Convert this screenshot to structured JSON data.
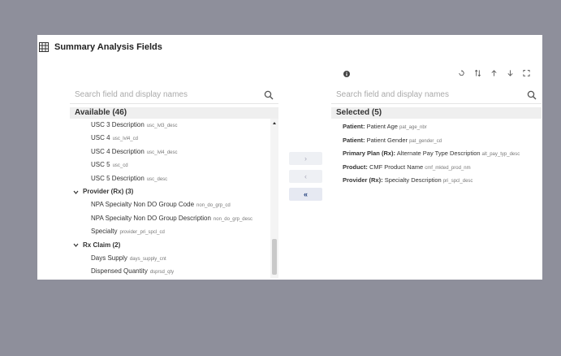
{
  "header": {
    "title": "Summary Analysis Fields",
    "icon": "table-grid-icon"
  },
  "available": {
    "search_placeholder": "Search field and display names",
    "title": "Available (46)",
    "rows": [
      {
        "type": "item",
        "label": "USC 3 Description",
        "code": "usc_lvl3_desc"
      },
      {
        "type": "item",
        "label": "USC 4",
        "code": "usc_lvl4_cd"
      },
      {
        "type": "item",
        "label": "USC 4 Description",
        "code": "usc_lvl4_desc"
      },
      {
        "type": "item",
        "label": "USC 5",
        "code": "usc_cd"
      },
      {
        "type": "item",
        "label": "USC 5 Description",
        "code": "usc_desc"
      },
      {
        "type": "group",
        "label": "Provider (Rx) (3)"
      },
      {
        "type": "item",
        "label": "NPA Specialty Non DO Group Code",
        "code": "non_do_grp_cd"
      },
      {
        "type": "item",
        "label": "NPA Specialty Non DO Group Description",
        "code": "non_do_grp_desc"
      },
      {
        "type": "item",
        "label": "Specialty",
        "code": "provider_pri_spcl_cd"
      },
      {
        "type": "group",
        "label": "Rx Claim (2)"
      },
      {
        "type": "item",
        "label": "Days Supply",
        "code": "days_supply_cnt"
      },
      {
        "type": "item",
        "label": "Dispensed Quantity",
        "code": "dsprsd_qty"
      }
    ]
  },
  "buttons": {
    "move_right": "›",
    "move_left": "‹",
    "remove_all": "«"
  },
  "selected": {
    "search_placeholder": "Search field and display names",
    "title": "Selected (5)",
    "rows": [
      {
        "prefix": "Patient:",
        "label": "Patient Age",
        "code": "pat_age_nbr"
      },
      {
        "prefix": "Patient:",
        "label": "Patient Gender",
        "code": "pat_gender_cd"
      },
      {
        "prefix": "Primary Plan (Rx):",
        "label": "Alternate Pay Type Description",
        "code": "alt_pay_typ_desc"
      },
      {
        "prefix": "Product:",
        "label": "CMF Product Name",
        "code": "cmf_mkted_prod_nm"
      },
      {
        "prefix": "Provider (Rx):",
        "label": "Specialty Description",
        "code": "pri_spcl_desc"
      }
    ]
  },
  "toolbar_icons": [
    "reset-icon",
    "sort-icon",
    "move-up-icon",
    "move-down-icon",
    "expand-icon"
  ]
}
